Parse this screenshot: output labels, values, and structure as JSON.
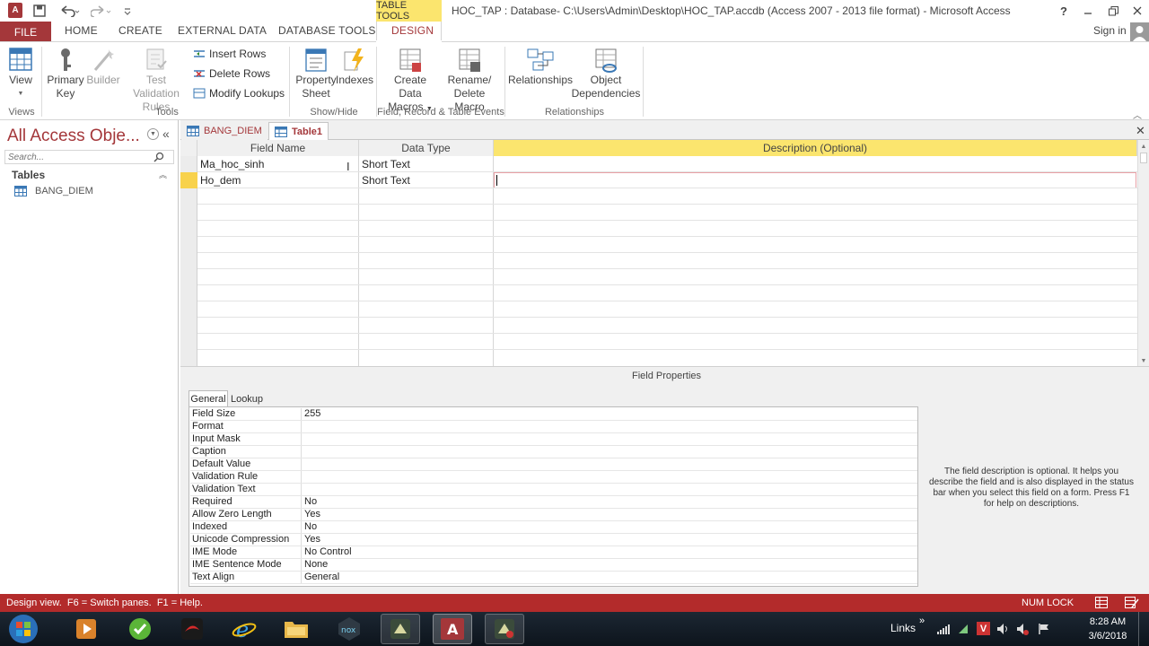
{
  "title": {
    "table_tools": "TABLE TOOLS",
    "window_title": "HOC_TAP : Database- C:\\Users\\Admin\\Desktop\\HOC_TAP.accdb (Access 2007 - 2013 file format) - Microsoft Access",
    "help": "?"
  },
  "tabs": [
    "FILE",
    "HOME",
    "CREATE",
    "EXTERNAL DATA",
    "DATABASE TOOLS",
    "DESIGN"
  ],
  "sign_in": "Sign in",
  "ribbon": {
    "view": "View",
    "primary_key_1": "Primary",
    "primary_key_2": "Key",
    "builder": "Builder",
    "test_rules_1": "Test Validation",
    "test_rules_2": "Rules",
    "insert_rows": "Insert Rows",
    "delete_rows": "Delete Rows",
    "modify_lookups": "Modify Lookups",
    "property_sheet_1": "Property",
    "property_sheet_2": "Sheet",
    "indexes": "Indexes",
    "create_macros_1": "Create Data",
    "create_macros_2": "Macros",
    "rename_macro_1": "Rename/",
    "rename_macro_2": "Delete Macro",
    "relationships": "Relationships",
    "object_deps_1": "Object",
    "object_deps_2": "Dependencies",
    "group_views": "Views",
    "group_tools": "Tools",
    "group_showhide": "Show/Hide",
    "group_events": "Field, Record & Table Events",
    "group_relationships": "Relationships"
  },
  "nav": {
    "title": "All Access Obje...",
    "search_placeholder": "Search...",
    "section": "Tables",
    "items": [
      "BANG_DIEM"
    ]
  },
  "doc_tabs": [
    "BANG_DIEM",
    "Table1"
  ],
  "grid": {
    "headers": [
      "Field Name",
      "Data Type",
      "Description (Optional)"
    ],
    "rows": [
      {
        "field": "Ma_hoc_sinh",
        "type": "Short Text",
        "desc": ""
      },
      {
        "field": "Ho_dem",
        "type": "Short Text",
        "desc": ""
      }
    ]
  },
  "props": {
    "title": "Field Properties",
    "tabs": [
      "General",
      "Lookup"
    ],
    "rows": [
      [
        "Field Size",
        "255"
      ],
      [
        "Format",
        ""
      ],
      [
        "Input Mask",
        ""
      ],
      [
        "Caption",
        ""
      ],
      [
        "Default Value",
        ""
      ],
      [
        "Validation Rule",
        ""
      ],
      [
        "Validation Text",
        ""
      ],
      [
        "Required",
        "No"
      ],
      [
        "Allow Zero Length",
        "Yes"
      ],
      [
        "Indexed",
        "No"
      ],
      [
        "Unicode Compression",
        "Yes"
      ],
      [
        "IME Mode",
        "No Control"
      ],
      [
        "IME Sentence Mode",
        "None"
      ],
      [
        "Text Align",
        "General"
      ]
    ],
    "help": "The field description is optional. It helps you describe the field and is also displayed in the status bar when you select this field on a form. Press F1 for help on descriptions."
  },
  "status": {
    "left": "Design view.  F6 = Switch panes.  F1 = Help.",
    "right": "NUM LOCK"
  },
  "taskbar": {
    "links": "Links",
    "time": "8:28 AM",
    "date": "3/6/2018"
  },
  "colors": {
    "accent": "#a4373a",
    "status": "#b32b2b",
    "header_yellow": "#fbe56e",
    "selector_yellow": "#f8d24c"
  }
}
